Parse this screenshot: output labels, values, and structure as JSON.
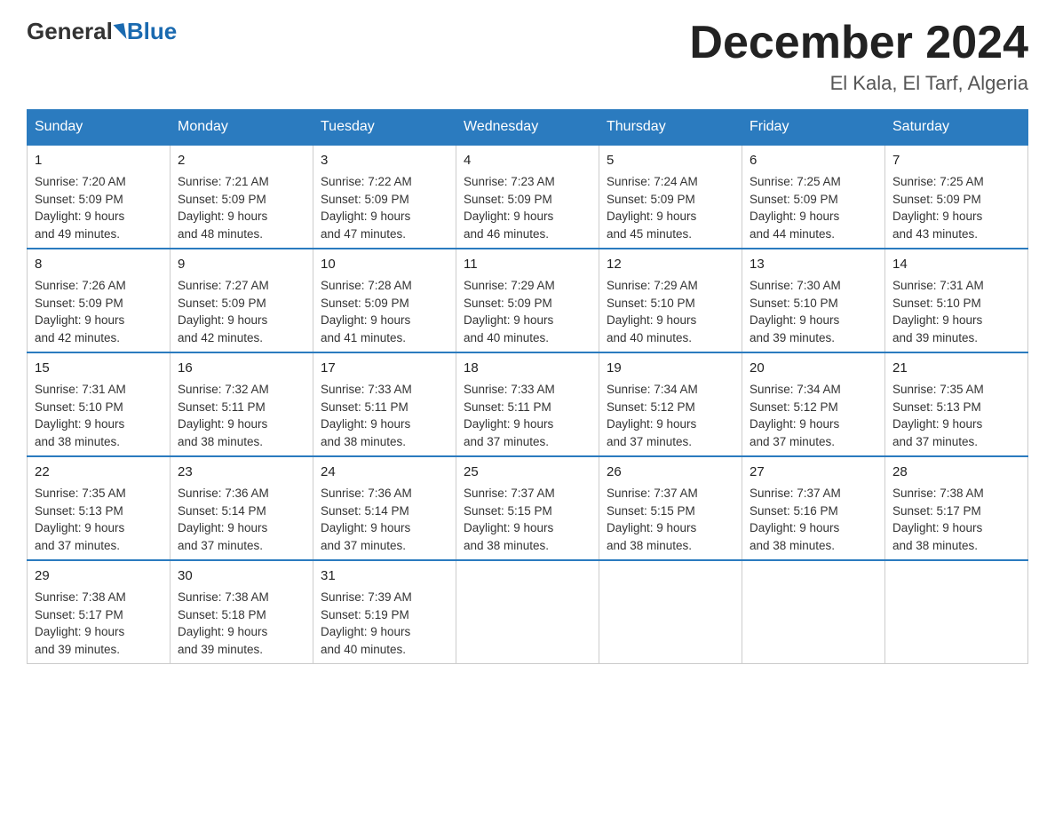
{
  "header": {
    "logo_general": "General",
    "logo_blue": "Blue",
    "title": "December 2024",
    "location": "El Kala, El Tarf, Algeria"
  },
  "days_of_week": [
    "Sunday",
    "Monday",
    "Tuesday",
    "Wednesday",
    "Thursday",
    "Friday",
    "Saturday"
  ],
  "weeks": [
    [
      {
        "day": "1",
        "sunrise": "7:20 AM",
        "sunset": "5:09 PM",
        "daylight": "9 hours and 49 minutes."
      },
      {
        "day": "2",
        "sunrise": "7:21 AM",
        "sunset": "5:09 PM",
        "daylight": "9 hours and 48 minutes."
      },
      {
        "day": "3",
        "sunrise": "7:22 AM",
        "sunset": "5:09 PM",
        "daylight": "9 hours and 47 minutes."
      },
      {
        "day": "4",
        "sunrise": "7:23 AM",
        "sunset": "5:09 PM",
        "daylight": "9 hours and 46 minutes."
      },
      {
        "day": "5",
        "sunrise": "7:24 AM",
        "sunset": "5:09 PM",
        "daylight": "9 hours and 45 minutes."
      },
      {
        "day": "6",
        "sunrise": "7:25 AM",
        "sunset": "5:09 PM",
        "daylight": "9 hours and 44 minutes."
      },
      {
        "day": "7",
        "sunrise": "7:25 AM",
        "sunset": "5:09 PM",
        "daylight": "9 hours and 43 minutes."
      }
    ],
    [
      {
        "day": "8",
        "sunrise": "7:26 AM",
        "sunset": "5:09 PM",
        "daylight": "9 hours and 42 minutes."
      },
      {
        "day": "9",
        "sunrise": "7:27 AM",
        "sunset": "5:09 PM",
        "daylight": "9 hours and 42 minutes."
      },
      {
        "day": "10",
        "sunrise": "7:28 AM",
        "sunset": "5:09 PM",
        "daylight": "9 hours and 41 minutes."
      },
      {
        "day": "11",
        "sunrise": "7:29 AM",
        "sunset": "5:09 PM",
        "daylight": "9 hours and 40 minutes."
      },
      {
        "day": "12",
        "sunrise": "7:29 AM",
        "sunset": "5:10 PM",
        "daylight": "9 hours and 40 minutes."
      },
      {
        "day": "13",
        "sunrise": "7:30 AM",
        "sunset": "5:10 PM",
        "daylight": "9 hours and 39 minutes."
      },
      {
        "day": "14",
        "sunrise": "7:31 AM",
        "sunset": "5:10 PM",
        "daylight": "9 hours and 39 minutes."
      }
    ],
    [
      {
        "day": "15",
        "sunrise": "7:31 AM",
        "sunset": "5:10 PM",
        "daylight": "9 hours and 38 minutes."
      },
      {
        "day": "16",
        "sunrise": "7:32 AM",
        "sunset": "5:11 PM",
        "daylight": "9 hours and 38 minutes."
      },
      {
        "day": "17",
        "sunrise": "7:33 AM",
        "sunset": "5:11 PM",
        "daylight": "9 hours and 38 minutes."
      },
      {
        "day": "18",
        "sunrise": "7:33 AM",
        "sunset": "5:11 PM",
        "daylight": "9 hours and 37 minutes."
      },
      {
        "day": "19",
        "sunrise": "7:34 AM",
        "sunset": "5:12 PM",
        "daylight": "9 hours and 37 minutes."
      },
      {
        "day": "20",
        "sunrise": "7:34 AM",
        "sunset": "5:12 PM",
        "daylight": "9 hours and 37 minutes."
      },
      {
        "day": "21",
        "sunrise": "7:35 AM",
        "sunset": "5:13 PM",
        "daylight": "9 hours and 37 minutes."
      }
    ],
    [
      {
        "day": "22",
        "sunrise": "7:35 AM",
        "sunset": "5:13 PM",
        "daylight": "9 hours and 37 minutes."
      },
      {
        "day": "23",
        "sunrise": "7:36 AM",
        "sunset": "5:14 PM",
        "daylight": "9 hours and 37 minutes."
      },
      {
        "day": "24",
        "sunrise": "7:36 AM",
        "sunset": "5:14 PM",
        "daylight": "9 hours and 37 minutes."
      },
      {
        "day": "25",
        "sunrise": "7:37 AM",
        "sunset": "5:15 PM",
        "daylight": "9 hours and 38 minutes."
      },
      {
        "day": "26",
        "sunrise": "7:37 AM",
        "sunset": "5:15 PM",
        "daylight": "9 hours and 38 minutes."
      },
      {
        "day": "27",
        "sunrise": "7:37 AM",
        "sunset": "5:16 PM",
        "daylight": "9 hours and 38 minutes."
      },
      {
        "day": "28",
        "sunrise": "7:38 AM",
        "sunset": "5:17 PM",
        "daylight": "9 hours and 38 minutes."
      }
    ],
    [
      {
        "day": "29",
        "sunrise": "7:38 AM",
        "sunset": "5:17 PM",
        "daylight": "9 hours and 39 minutes."
      },
      {
        "day": "30",
        "sunrise": "7:38 AM",
        "sunset": "5:18 PM",
        "daylight": "9 hours and 39 minutes."
      },
      {
        "day": "31",
        "sunrise": "7:39 AM",
        "sunset": "5:19 PM",
        "daylight": "9 hours and 40 minutes."
      },
      null,
      null,
      null,
      null
    ]
  ],
  "labels": {
    "sunrise": "Sunrise:",
    "sunset": "Sunset:",
    "daylight": "Daylight:"
  }
}
